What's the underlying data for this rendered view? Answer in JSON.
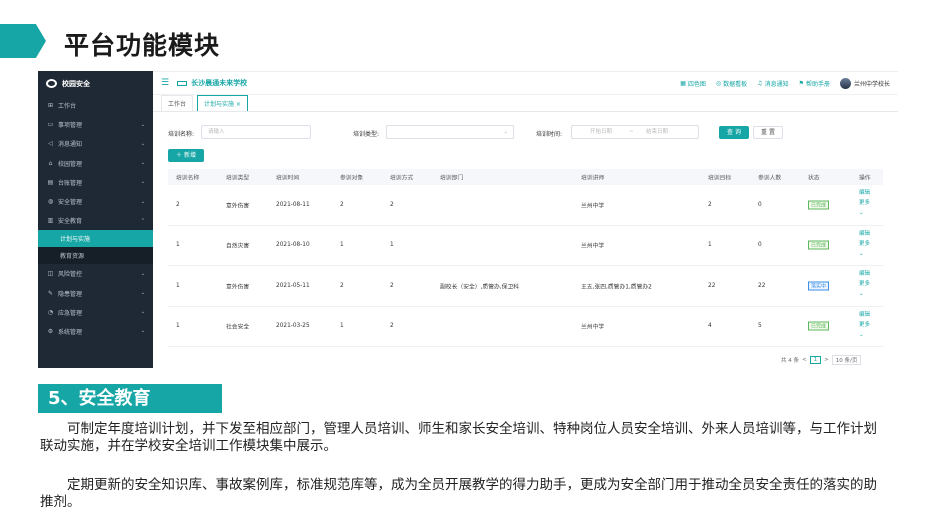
{
  "slide": {
    "title": "平台功能模块",
    "section": "5、安全教育",
    "paragraphs": [
      "可制定年度培训计划，并下发至相应部门，管理人员培训、师生和家长安全培训、特种岗位人员安全培训、外来人员培训等，与工作计划联动实施，并在学校安全培训工作模块集中展示。",
      "定期更新的安全知识库、事故案例库，标准规范库等，成为全员开展教学的得力助手，更成为安全部门用于推动全员安全责任的落实的助推剂。"
    ]
  },
  "app": {
    "brand": "校园安全",
    "school": "长沙晨通未来学校",
    "tools": [
      "四色图",
      "数据看板",
      "消息通知",
      "帮助手册"
    ],
    "user": "兰州中学校长",
    "tabs": [
      "工作台",
      "计划与实施 ×"
    ],
    "sidebar": [
      {
        "label": "工作台",
        "icon": "⊞",
        "chev": ""
      },
      {
        "label": "事项管理",
        "icon": "▭",
        "chev": "⌄"
      },
      {
        "label": "消息通知",
        "icon": "◁",
        "chev": "⌄"
      },
      {
        "label": "校园管理",
        "icon": "⌂",
        "chev": "⌄"
      },
      {
        "label": "台账管理",
        "icon": "▤",
        "chev": "⌄"
      },
      {
        "label": "安全管理",
        "icon": "◍",
        "chev": "⌄"
      },
      {
        "label": "安全教育",
        "icon": "▥",
        "chev": "⌃"
      }
    ],
    "sidebar_sub": [
      "计划与实施",
      "教育资源"
    ],
    "sidebar_after": [
      {
        "label": "风险管控",
        "icon": "◫",
        "chev": "⌄"
      },
      {
        "label": "隐患管理",
        "icon": "✎",
        "chev": "⌄"
      },
      {
        "label": "应急管理",
        "icon": "◔",
        "chev": "⌄"
      },
      {
        "label": "系统管理",
        "icon": "⚙",
        "chev": "⌄"
      }
    ],
    "filters": {
      "name_label": "培训名称:",
      "name_placeholder": "请输入",
      "type_label": "培训类型:",
      "time_label": "培训时间:",
      "start_placeholder": "开始日期",
      "sep": "~",
      "end_placeholder": "结束日期",
      "query": "查 询",
      "reset": "重 置",
      "add": "＋ 新增"
    },
    "table": {
      "headers": [
        "培训名称",
        "培训类型",
        "培训时间",
        "参训对象",
        "培训方式",
        "培训部门",
        "培训讲师",
        "培训目标",
        "参训人数",
        "状态",
        "操作"
      ],
      "rows": [
        {
          "name": "2",
          "type": "意外伤害",
          "time": "2021-08-11",
          "target": "2",
          "mode": "2",
          "dept": "",
          "lecturer": "兰州中学",
          "goal": "2",
          "count": "0",
          "status": "已完成",
          "status_color": "#5cb85c"
        },
        {
          "name": "1",
          "type": "自然灾害",
          "time": "2021-08-10",
          "target": "1",
          "mode": "1",
          "dept": "",
          "lecturer": "兰州中学",
          "goal": "1",
          "count": "0",
          "status": "已完成",
          "status_color": "#5cb85c"
        },
        {
          "name": "1",
          "type": "意外伤害",
          "time": "2021-05-11",
          "target": "2",
          "mode": "2",
          "dept": "副校长（安全）,质管办,保卫科",
          "lecturer": "王五,张四,质管办1,质管办2",
          "goal": "22",
          "count": "22",
          "status": "落实中",
          "status_color": "#3a8ee6"
        },
        {
          "name": "1",
          "type": "社会安全",
          "time": "2021-03-25",
          "target": "1",
          "mode": "2",
          "dept": "",
          "lecturer": "兰州中学",
          "goal": "4",
          "count": "5",
          "status": "已完成",
          "status_color": "#5cb85c"
        }
      ],
      "ops": {
        "edit": "编辑",
        "more": "更多",
        "more_chev": "⌄"
      }
    },
    "pager": {
      "total": "共 4 条",
      "prev": "<",
      "page": "1",
      "next": ">",
      "size": "10 条/页"
    }
  }
}
